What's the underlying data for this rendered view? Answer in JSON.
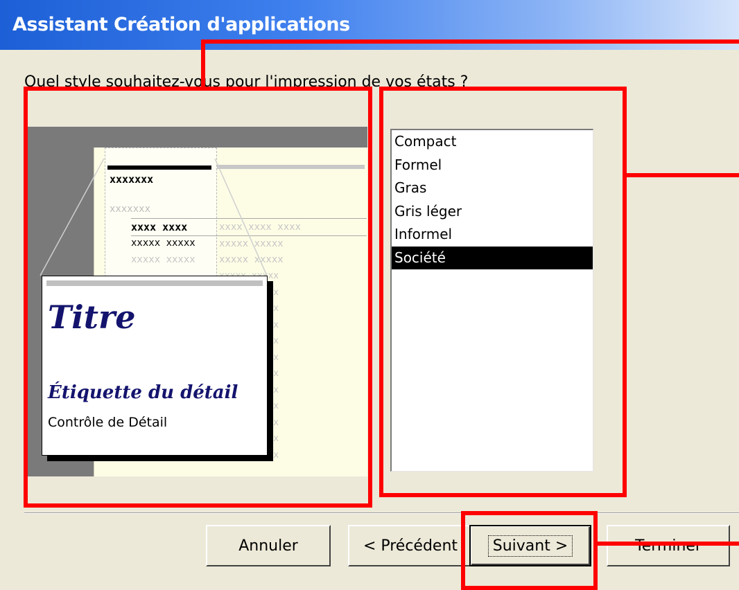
{
  "window": {
    "title": "Assistant Création d'applications"
  },
  "question": "Quel style souhaitez-vous pour l'impression de vos états ?",
  "preview": {
    "header_x": "xxxxxxx",
    "faded_x": "xxxxxxx",
    "row1_bold": "xxxx xxxx",
    "row2_bold": "xxxxx xxxxx",
    "grid_cell": "xxxxx xxxxx",
    "grid_head": "xxxx xxxx xxxx",
    "card_title": "Titre",
    "card_label": "Étiquette du détail",
    "card_control": "Contrôle de Détail"
  },
  "styles": {
    "items": [
      "Compact",
      "Formel",
      "Gras",
      "Gris léger",
      "Informel",
      "Société"
    ],
    "selected": "Société"
  },
  "buttons": {
    "cancel": "Annuler",
    "previous": "< Précédent",
    "next": "Suivant >",
    "finish": "Terminer"
  },
  "colors": {
    "annotation": "#ff0000",
    "titlebar": "#1c5fd6",
    "dialog_bg": "#ece9d8"
  }
}
